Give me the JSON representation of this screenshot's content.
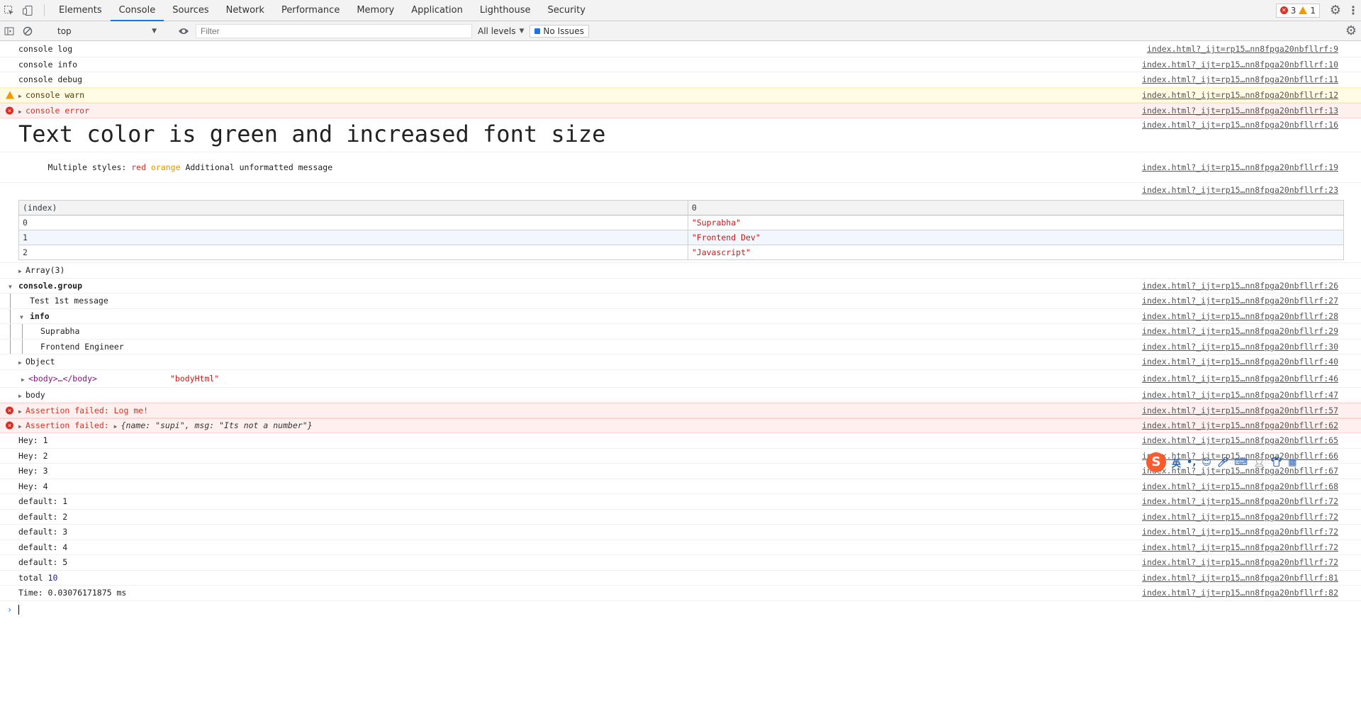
{
  "tabs": [
    "Elements",
    "Console",
    "Sources",
    "Network",
    "Performance",
    "Memory",
    "Application",
    "Lighthouse",
    "Security"
  ],
  "active_tab": "Console",
  "counts": {
    "errors": "3",
    "warnings": "1"
  },
  "toolbar": {
    "context": "top",
    "filter_placeholder": "Filter",
    "levels": "All levels",
    "issues": "No Issues"
  },
  "messages": [
    {
      "type": "log",
      "text": "console log",
      "src": "index.html?_ijt=rp15…nn8fpga20nbfllrf:9"
    },
    {
      "type": "log",
      "text": "console info",
      "src": "index.html?_ijt=rp15…nn8fpga20nbfllrf:10"
    },
    {
      "type": "log",
      "text": "console debug",
      "src": "index.html?_ijt=rp15…nn8fpga20nbfllrf:11"
    },
    {
      "type": "warn",
      "text": "console warn",
      "src": "index.html?_ijt=rp15…nn8fpga20nbfllrf:12"
    },
    {
      "type": "error",
      "text": "console error",
      "src": "index.html?_ijt=rp15…nn8fpga20nbfllrf:13"
    },
    {
      "type": "big",
      "text": "Text color is green and increased font size",
      "src": "index.html?_ijt=rp15…nn8fpga20nbfllrf:16"
    },
    {
      "type": "styled",
      "prefix": "Multiple styles: ",
      "red": "red",
      "orange": "orange",
      "suffix": " Additional unformatted message",
      "src": "index.html?_ijt=rp15…nn8fpga20nbfllrf:19"
    },
    {
      "type": "table",
      "src": "index.html?_ijt=rp15…nn8fpga20nbfllrf:23"
    }
  ],
  "table": {
    "headers": [
      "(index)",
      "0"
    ],
    "rows": [
      [
        "0",
        "\"Suprabha\""
      ],
      [
        "1",
        "\"Frontend Dev\""
      ],
      [
        "2",
        "\"Javascript\""
      ]
    ],
    "footer": "Array(3)"
  },
  "group": {
    "label": "console.group",
    "src": "index.html?_ijt=rp15…nn8fpga20nbfllrf:26",
    "child1": {
      "text": "Test 1st message",
      "src": "index.html?_ijt=rp15…nn8fpga20nbfllrf:27"
    },
    "sub_label": "info",
    "sub_src": "index.html?_ijt=rp15…nn8fpga20nbfllrf:28",
    "sub1": {
      "text": "Suprabha",
      "src": "index.html?_ijt=rp15…nn8fpga20nbfllrf:29"
    },
    "sub2": {
      "text": "Frontend Engineer",
      "src": "index.html?_ijt=rp15…nn8fpga20nbfllrf:30"
    }
  },
  "after_group": {
    "object": {
      "text": "Object",
      "src": "index.html?_ijt=rp15…nn8fpga20nbfllrf:40"
    },
    "body_html": {
      "tag": "<body>…</body>",
      "value": "\"bodyHtml\"",
      "src": "index.html?_ijt=rp15…nn8fpga20nbfllrf:46"
    },
    "body": {
      "text": "body",
      "src": "index.html?_ijt=rp15…nn8fpga20nbfllrf:47"
    },
    "assert1": {
      "text": "Assertion failed: Log me!",
      "src": "index.html?_ijt=rp15…nn8fpga20nbfllrf:57"
    },
    "assert2": {
      "text": "Assertion failed: ",
      "obj": "{name: \"supi\", msg: \"Its not a number\"}",
      "src": "index.html?_ijt=rp15…nn8fpga20nbfllrf:62"
    }
  },
  "tail": [
    {
      "text": "Hey: 1",
      "src": "index.html?_ijt=rp15…nn8fpga20nbfllrf:65"
    },
    {
      "text": "Hey: 2",
      "src": "index.html?_ijt=rp15…nn8fpga20nbfllrf:66"
    },
    {
      "text": "Hey: 3",
      "src": "index.html?_ijt=rp15…nn8fpga20nbfllrf:67"
    },
    {
      "text": "Hey: 4",
      "src": "index.html?_ijt=rp15…nn8fpga20nbfllrf:68"
    },
    {
      "text": "default: 1",
      "src": "index.html?_ijt=rp15…nn8fpga20nbfllrf:72"
    },
    {
      "text": "default: 2",
      "src": "index.html?_ijt=rp15…nn8fpga20nbfllrf:72"
    },
    {
      "text": "default: 3",
      "src": "index.html?_ijt=rp15…nn8fpga20nbfllrf:72"
    },
    {
      "text": "default: 4",
      "src": "index.html?_ijt=rp15…nn8fpga20nbfllrf:72"
    },
    {
      "text": "default: 5",
      "src": "index.html?_ijt=rp15…nn8fpga20nbfllrf:72"
    }
  ],
  "total": {
    "label": "total ",
    "value": "10",
    "src": "index.html?_ijt=rp15…nn8fpga20nbfllrf:81"
  },
  "time": {
    "text": "Time: 0.03076171875 ms",
    "src": "index.html?_ijt=rp15…nn8fpga20nbfllrf:82"
  },
  "ime": {
    "lang": "英",
    "punct": "•,"
  },
  "colors": {
    "accent": "#1a73e8",
    "error": "#d93025",
    "warning": "#f29900",
    "green_text": "#008000",
    "orange_text": "#e69500"
  }
}
